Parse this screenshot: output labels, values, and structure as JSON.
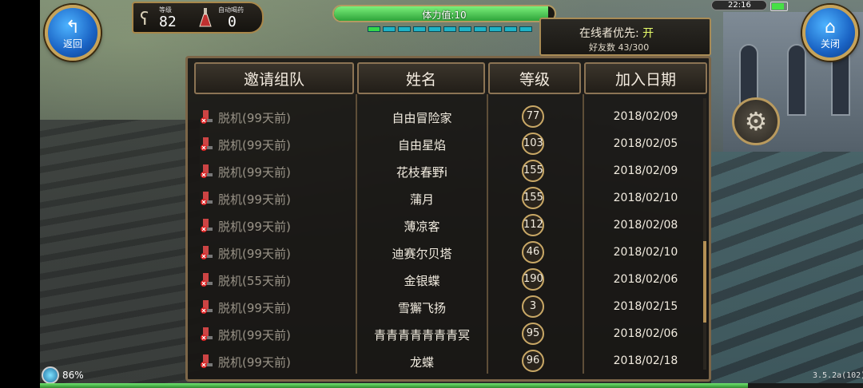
{
  "header": {
    "back_button": {
      "label": "返回",
      "icon": "back-arrow-icon"
    },
    "close_button": {
      "label": "关闭",
      "icon": "home-icon"
    },
    "level": {
      "caption": "等级",
      "value": "82"
    },
    "auto_potion": {
      "caption": "自动喝药",
      "value": "0"
    },
    "stamina": {
      "label": "体力值:10",
      "fraction": 0.97
    },
    "clock": "22:16",
    "battery_fraction": 0.85
  },
  "online_priority": {
    "label": "在线者优先:",
    "value": "开",
    "friend_count": "好友数 43/300"
  },
  "table": {
    "headers": [
      "邀请组队",
      "姓名",
      "等级",
      "加入日期"
    ],
    "rows": [
      {
        "status": "脱机(99天前)",
        "name": "自由冒险家",
        "level": "77",
        "date": "2018/02/09"
      },
      {
        "status": "脱机(99天前)",
        "name": "自由星焰",
        "level": "103",
        "date": "2018/02/05"
      },
      {
        "status": "脱机(99天前)",
        "name": "花枝春野i",
        "level": "155",
        "date": "2018/02/09"
      },
      {
        "status": "脱机(99天前)",
        "name": "蒲月",
        "level": "155",
        "date": "2018/02/10"
      },
      {
        "status": "脱机(99天前)",
        "name": "薄凉客",
        "level": "112",
        "date": "2018/02/08"
      },
      {
        "status": "脱机(99天前)",
        "name": "迪赛尔贝塔",
        "level": "46",
        "date": "2018/02/10"
      },
      {
        "status": "脱机(55天前)",
        "name": "金银蝶",
        "level": "190",
        "date": "2018/02/06"
      },
      {
        "status": "脱机(99天前)",
        "name": "雪獬飞扬",
        "level": "3",
        "date": "2018/02/15"
      },
      {
        "status": "脱机(99天前)",
        "name": "青青青青青青青冥",
        "level": "95",
        "date": "2018/02/06"
      },
      {
        "status": "脱机(99天前)",
        "name": "龙蝶",
        "level": "96",
        "date": "2018/02/18"
      }
    ],
    "scroll_position": 0.75,
    "scroll_visible_fraction": 0.3
  },
  "footer": {
    "signal_text": "86%",
    "version": "3.5.2a(102)",
    "exp_fraction": 0.86
  },
  "colors": {
    "panel_border": "#8c7454",
    "online_value": "#e9ff6b",
    "stamina_fill": "#2fa43a",
    "button_blue": "#1a63c4",
    "gold_trim": "#c6a35a"
  }
}
